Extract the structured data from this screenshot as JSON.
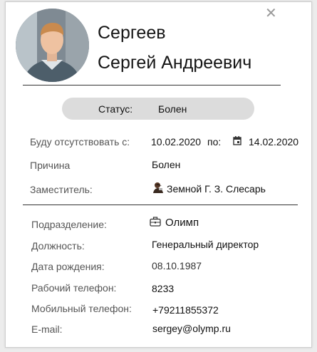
{
  "header": {
    "last_name": "Сергеев",
    "first_middle": "Сергей Андреевич",
    "close_glyph": "✕",
    "avatar_icon": "user-photo"
  },
  "status": {
    "label": "Статус:",
    "value": "Болен"
  },
  "absence": {
    "label": "Буду отсутствовать с:",
    "from": "10.02.2020",
    "to_label": "по:",
    "to": "14.02.2020",
    "calendar_icon": "calendar-icon"
  },
  "reason": {
    "label": "Причина",
    "value": "Болен"
  },
  "deputy": {
    "label": "Заместитель:",
    "value": "Земной Г. З. Слесарь",
    "icon": "person-icon"
  },
  "info": {
    "department_label": "Подразделение:",
    "department": "Олимп",
    "department_icon": "briefcase-icon",
    "position_label": "Должность:",
    "position": "Генеральный директор",
    "birth_label": "Дата рождения:",
    "birth": "08.10.1987",
    "work_phone_label": "Рабочий телефон:",
    "work_phone": "8233",
    "mobile_label": "Мобильный телефон:",
    "mobile": "+79211855372",
    "email_label": "E-mail:",
    "email": "sergey@olymp.ru"
  }
}
